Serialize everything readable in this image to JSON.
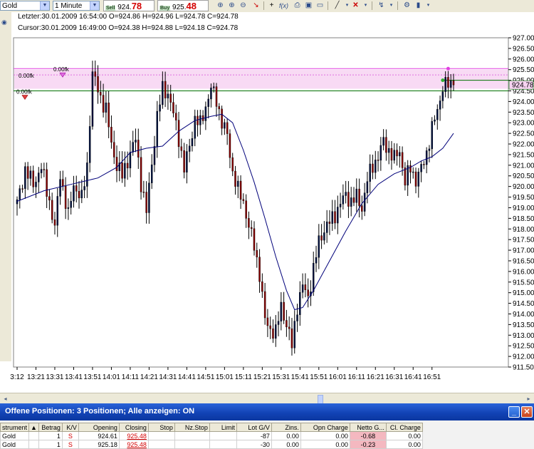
{
  "toolbar": {
    "instrument": "Gold",
    "timeframe": "1 Minute",
    "sell_label": "Sell",
    "sell_small": "924.",
    "sell_big": "78",
    "buy_label": "Buy",
    "buy_small": "925.",
    "buy_big": "48",
    "tool_icons": [
      "zoom-in-icon",
      "zoom-in-icon",
      "zoom-out-icon",
      "cursor-icon",
      "crosshair-icon",
      "fx-icon",
      "print-icon",
      "save-icon",
      "window-icon",
      "line-icon",
      "delete-icon",
      "arrow-icon",
      "settings-icon",
      "bars-icon"
    ]
  },
  "info": {
    "last": "Letzter:30.01.2009 16:54:00 O=924.86 H=924.96 L=924.78 C=924.78",
    "cursor": "Cursor:30.01.2009 16:49:00 O=924.38 H=924.88 L=924.18 C=924.78"
  },
  "chart_data": {
    "type": "candlestick",
    "title": "",
    "xlabel": "",
    "ylabel": "",
    "ylim": [
      911.5,
      927.0
    ],
    "x_ticks": [
      "3:12",
      "13:21",
      "13:31",
      "13:41",
      "13:51",
      "14:01",
      "14:11",
      "14:21",
      "14:31",
      "14:41",
      "14:51",
      "15:01",
      "15:11",
      "15:21",
      "15:31",
      "15:41",
      "15:51",
      "16:01",
      "16:11",
      "16:21",
      "16:31",
      "16:41",
      "16:51"
    ],
    "y_ticks": [
      "911.50",
      "912.00",
      "912.50",
      "913.00",
      "913.50",
      "914.00",
      "914.50",
      "915.00",
      "915.50",
      "916.00",
      "916.50",
      "917.00",
      "917.50",
      "918.00",
      "918.50",
      "919.00",
      "919.50",
      "920.00",
      "920.50",
      "921.00",
      "921.50",
      "922.00",
      "922.50",
      "923.00",
      "923.50",
      "924.00",
      "924.50",
      "925.00",
      "925.50",
      "926.00",
      "926.50",
      "927.00"
    ],
    "price_close": 924.78,
    "price_close_label": "924.78",
    "order_labels": [
      "0.00fk",
      "0.00fk",
      "0.00fk"
    ],
    "order_levels": [
      925.55,
      925.25,
      924.5
    ],
    "highlight_band": [
      924.6,
      925.5
    ],
    "anchors": [
      [
        0,
        919.2
      ],
      [
        3,
        920.8
      ],
      [
        6,
        920.1
      ],
      [
        9,
        920.9
      ],
      [
        12,
        919.3
      ],
      [
        14,
        918.0
      ],
      [
        16,
        920.6
      ],
      [
        19,
        918.6
      ],
      [
        21,
        920.1
      ],
      [
        24,
        919.4
      ],
      [
        26,
        921.0
      ],
      [
        28,
        925.3
      ],
      [
        31,
        924.2
      ],
      [
        33,
        923.6
      ],
      [
        35,
        922.0
      ],
      [
        37,
        921.0
      ],
      [
        39,
        920.5
      ],
      [
        42,
        921.6
      ],
      [
        44,
        922.2
      ],
      [
        46,
        920.2
      ],
      [
        48,
        918.8
      ],
      [
        50,
        921.1
      ],
      [
        52,
        923.3
      ],
      [
        54,
        924.6
      ],
      [
        56,
        924.4
      ],
      [
        58,
        923.4
      ],
      [
        60,
        922.3
      ],
      [
        62,
        920.8
      ],
      [
        64,
        921.9
      ],
      [
        66,
        923.2
      ],
      [
        68,
        922.9
      ],
      [
        70,
        923.8
      ],
      [
        72,
        924.6
      ],
      [
        74,
        924.1
      ],
      [
        76,
        923.0
      ],
      [
        78,
        922.4
      ],
      [
        80,
        920.7
      ],
      [
        82,
        919.8
      ],
      [
        84,
        919.3
      ],
      [
        86,
        918.1
      ],
      [
        88,
        917.2
      ],
      [
        90,
        915.9
      ],
      [
        92,
        913.7
      ],
      [
        94,
        913.3
      ],
      [
        96,
        913.1
      ],
      [
        98,
        914.4
      ],
      [
        100,
        913.5
      ],
      [
        102,
        912.5
      ],
      [
        104,
        914.4
      ],
      [
        106,
        915.3
      ],
      [
        108,
        914.8
      ],
      [
        110,
        916.1
      ],
      [
        112,
        917.4
      ],
      [
        114,
        918.0
      ],
      [
        116,
        918.3
      ],
      [
        118,
        918.7
      ],
      [
        120,
        919.2
      ],
      [
        122,
        919.6
      ],
      [
        124,
        919.3
      ],
      [
        126,
        919.5
      ],
      [
        128,
        919.0
      ],
      [
        130,
        920.3
      ],
      [
        132,
        921.0
      ],
      [
        134,
        921.4
      ],
      [
        136,
        922.1
      ],
      [
        138,
        921.7
      ],
      [
        140,
        921.3
      ],
      [
        142,
        921.7
      ],
      [
        144,
        920.2
      ],
      [
        146,
        920.9
      ],
      [
        148,
        920.3
      ],
      [
        150,
        920.8
      ],
      [
        152,
        921.6
      ],
      [
        154,
        922.7
      ],
      [
        156,
        923.6
      ],
      [
        158,
        924.7
      ],
      [
        160,
        924.8
      ],
      [
        162,
        924.78
      ]
    ],
    "ma_points": [
      [
        0,
        919.3
      ],
      [
        10,
        919.8
      ],
      [
        20,
        920.1
      ],
      [
        30,
        920.4
      ],
      [
        37,
        920.9
      ],
      [
        42,
        921.6
      ],
      [
        48,
        921.8
      ],
      [
        54,
        921.9
      ],
      [
        60,
        922.6
      ],
      [
        66,
        923.1
      ],
      [
        72,
        923.3
      ],
      [
        76,
        923.4
      ],
      [
        80,
        923.0
      ],
      [
        84,
        921.7
      ],
      [
        88,
        920.2
      ],
      [
        92,
        918.5
      ],
      [
        96,
        916.7
      ],
      [
        100,
        915.1
      ],
      [
        103,
        914.2
      ],
      [
        106,
        914.3
      ],
      [
        110,
        915.1
      ],
      [
        116,
        916.5
      ],
      [
        122,
        917.9
      ],
      [
        128,
        919.2
      ],
      [
        134,
        920.1
      ],
      [
        140,
        920.6
      ],
      [
        146,
        920.9
      ],
      [
        150,
        921.2
      ],
      [
        154,
        921.4
      ],
      [
        158,
        921.8
      ],
      [
        162,
        922.5
      ]
    ]
  },
  "scroll": {
    "left_arrow": "◂",
    "right_arrow": "▸"
  },
  "positions_panel": {
    "title": "Offene Positionen:  3 Positionen; Alle anzeigen: ON",
    "min_glyph": "_",
    "max_glyph": "□",
    "close_glyph": "✕",
    "headers": [
      "strument",
      "▲",
      "Betrag",
      "K/V",
      "Opening",
      "Closing",
      "Stop",
      "Nz.Stop",
      "Limit",
      "Lot G/V",
      "Zins.",
      "Opn Charge",
      "Netto G...",
      "Cl. Charge"
    ],
    "rows": [
      [
        "Gold",
        "",
        "1",
        "S",
        "924.61",
        "925.48",
        "",
        "",
        "",
        "-87",
        "0.00",
        "0.00",
        "-0.68",
        "0.00"
      ],
      [
        "Gold",
        "",
        "1",
        "S",
        "925.18",
        "925.48",
        "",
        "",
        "",
        "-30",
        "0.00",
        "0.00",
        "-0.23",
        "0.00"
      ]
    ]
  }
}
